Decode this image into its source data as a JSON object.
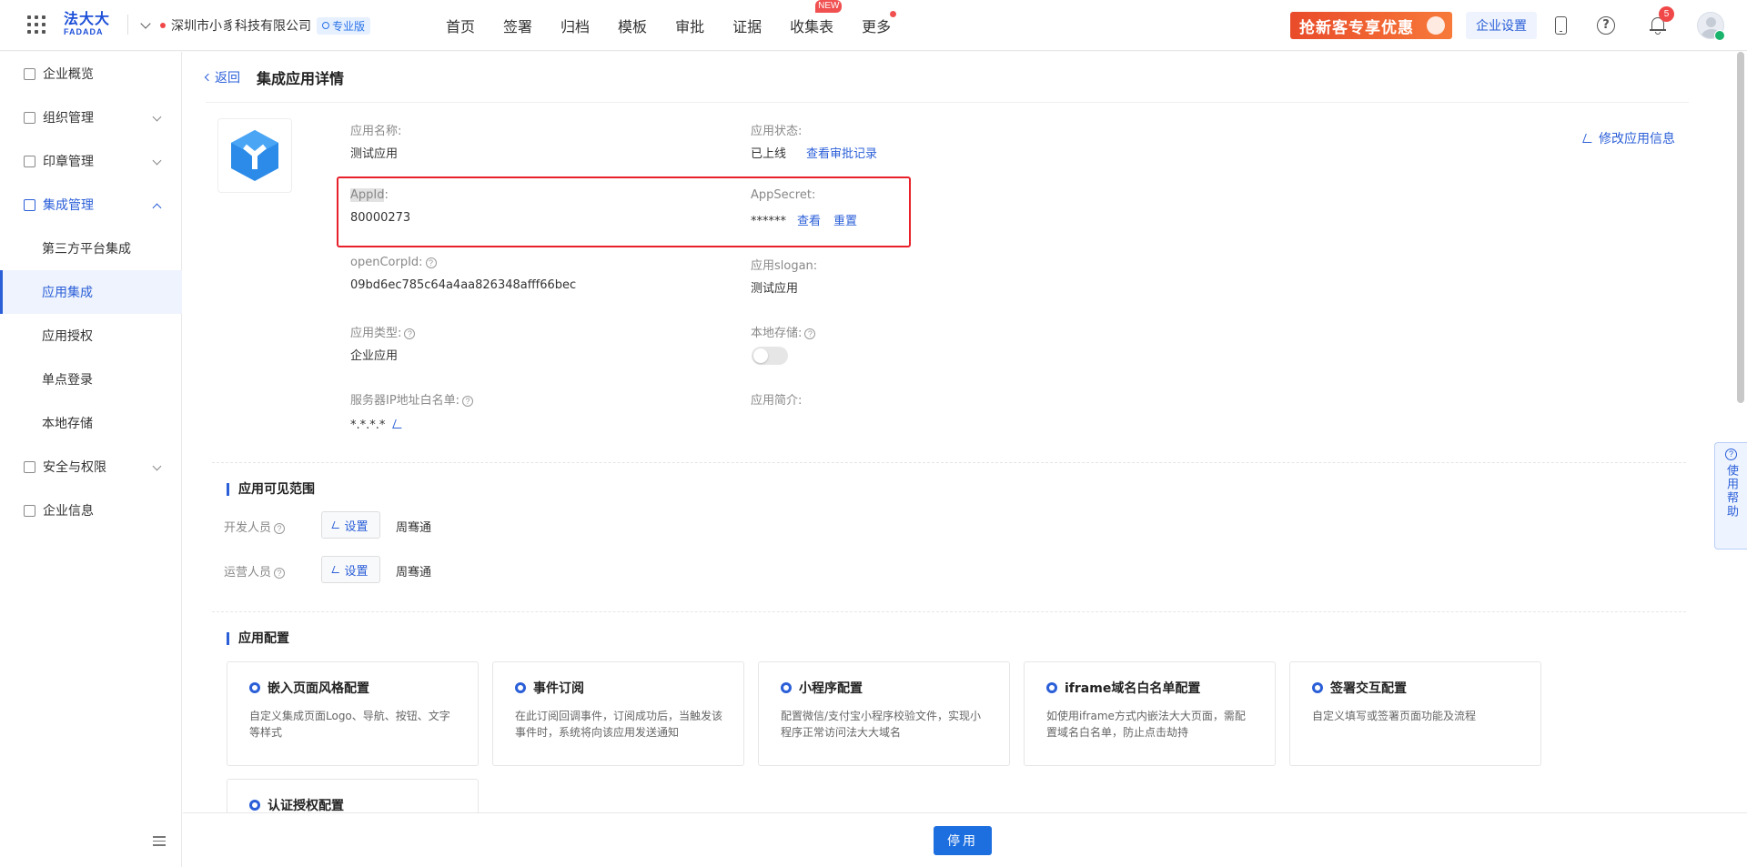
{
  "header": {
    "logo_cn": "法大大",
    "logo_en": "FADADA",
    "org_name": "深圳市小豸科技有限公司",
    "plan_badge": "专业版",
    "nav": [
      "首页",
      "签署",
      "归档",
      "模板",
      "审批",
      "证据",
      "收集表",
      "更多"
    ],
    "new_tag": "NEW",
    "promo": "抢新客专享优惠",
    "enterprise_settings": "企业设置",
    "notification_count": "5"
  },
  "sidebar": {
    "items": [
      {
        "label": "企业概览"
      },
      {
        "label": "组织管理"
      },
      {
        "label": "印章管理"
      },
      {
        "label": "集成管理"
      },
      {
        "label": "第三方平台集成"
      },
      {
        "label": "应用集成"
      },
      {
        "label": "应用授权"
      },
      {
        "label": "单点登录"
      },
      {
        "label": "本地存储"
      },
      {
        "label": "安全与权限"
      },
      {
        "label": "企业信息"
      }
    ]
  },
  "page": {
    "back": "返回",
    "title": "集成应用详情",
    "edit_app_info": "修改应用信息"
  },
  "app": {
    "name_label": "应用名称:",
    "name": "测试应用",
    "status_label": "应用状态:",
    "status": "已上线",
    "view_audit": "查看审批记录",
    "appid_label": "AppId",
    "appid_colon": ":",
    "appid": "80000273",
    "secret_label": "AppSecret:",
    "secret": "******",
    "view": "查看",
    "reset": "重置",
    "opencorp_label": "openCorpId:",
    "opencorp": "09bd6ec785c64a4aa826348afff66bec",
    "slogan_label": "应用slogan:",
    "slogan": "测试应用",
    "type_label": "应用类型:",
    "type": "企业应用",
    "local_storage_label": "本地存储:",
    "ip_label": "服务器IP地址白名单:",
    "ip": "*.*.*.*",
    "intro_label": "应用简介:"
  },
  "scope": {
    "title": "应用可见范围",
    "dev_label": "开发人员",
    "ops_label": "运营人员",
    "set": "设置",
    "dev_name": "周骞通",
    "ops_name": "周骞通"
  },
  "config": {
    "title": "应用配置",
    "cards": [
      {
        "title": "嵌入页面风格配置",
        "desc": "自定义集成页面Logo、导航、按钮、文字等样式"
      },
      {
        "title": "事件订阅",
        "desc": "在此订阅回调事件，订阅成功后，当触发该事件时，系统将向该应用发送通知"
      },
      {
        "title": "小程序配置",
        "desc": "配置微信/支付宝小程序校验文件，实现小程序正常访问法大大域名"
      },
      {
        "title": "iframe域名白名单配置",
        "desc": "如使用iframe方式内嵌法大大页面，需配置域名白名单，防止点击劫持"
      },
      {
        "title": "签署交互配置",
        "desc": "自定义填写或签署页面功能及流程"
      },
      {
        "title": "认证授权配置",
        "desc": ""
      }
    ]
  },
  "footer": {
    "stop": "停用"
  },
  "help_float": "使用帮助",
  "colors": {
    "primary": "#2b5fd8",
    "highlight_box": "#e8202a",
    "button": "#1d6fe0"
  }
}
